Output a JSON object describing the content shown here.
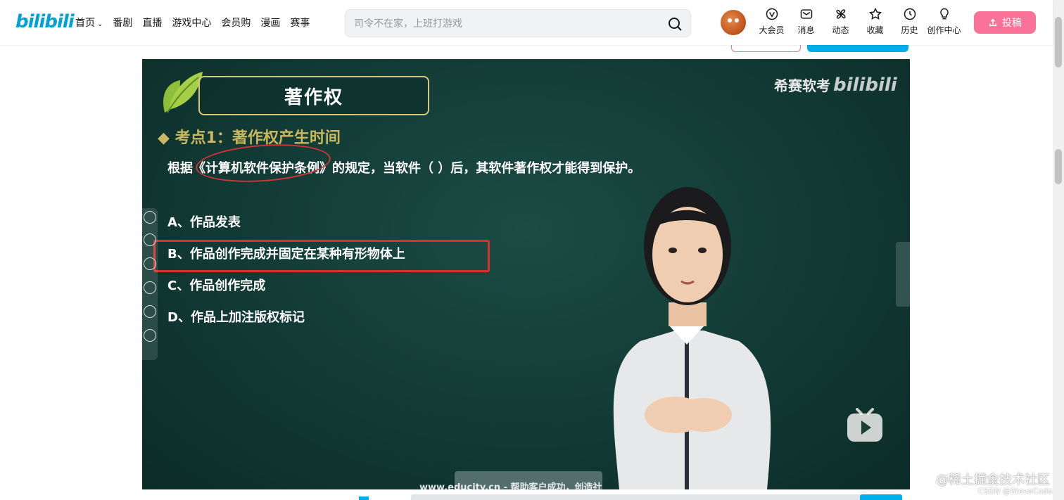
{
  "header": {
    "logo": "bilibili",
    "nav": [
      {
        "label": "首页",
        "has_dropdown": true
      },
      {
        "label": "番剧"
      },
      {
        "label": "直播"
      },
      {
        "label": "游戏中心"
      },
      {
        "label": "会员购"
      },
      {
        "label": "漫画"
      },
      {
        "label": "赛事"
      }
    ],
    "search": {
      "placeholder": "司令不在家，上班打游戏"
    },
    "right_icons": [
      {
        "icon": "vip-icon",
        "label": "大会员"
      },
      {
        "icon": "message-icon",
        "label": "消息"
      },
      {
        "icon": "dynamic-icon",
        "label": "动态"
      },
      {
        "icon": "favorite-icon",
        "label": "收藏"
      },
      {
        "icon": "history-icon",
        "label": "历史"
      },
      {
        "icon": "creator-icon",
        "label": "创作中心"
      }
    ],
    "upload_label": "投稿",
    "accent_color": "#00a1d6",
    "upload_color": "#fb7299"
  },
  "video": {
    "slide_title": "著作权",
    "watermark": "希赛软考",
    "watermark_logo": "bilibili",
    "key_point": "◆ 考点1：著作权产生时间",
    "question": "根据《计算机软件保护条例》的规定，当软件（ ）后，其软件著作权才能得到保护。",
    "options": [
      "A、作品发表",
      "B、作品创作完成并固定在某种有形物体上",
      "C、作品创作完成",
      "D、作品上加注版权标记"
    ],
    "highlighted_option": 1,
    "bottom_text": "www.educity.cn - 帮助客户成功，创造社",
    "bg_color": "#123a34",
    "highlight_color": "#d82f2f",
    "key_point_color": "#c9b860"
  },
  "overlays": {
    "juejin": "@稀土掘金技术社区",
    "csdn": "CSDN @SteveCode."
  }
}
